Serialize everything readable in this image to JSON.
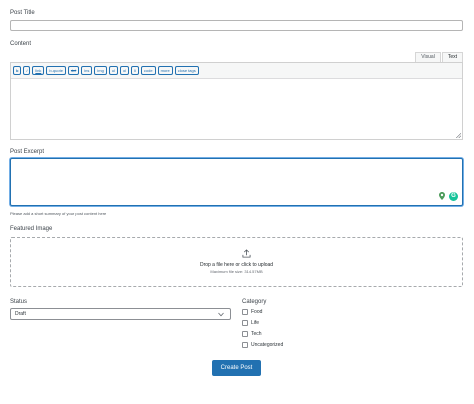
{
  "post_title": {
    "label": "Post Title",
    "value": ""
  },
  "content": {
    "label": "Content",
    "tabs": [
      "Visual",
      "Text"
    ],
    "active_tab": "Text",
    "toolbar": [
      "b",
      "i",
      "link",
      "b-quote",
      "del",
      "ins",
      "img",
      "ul",
      "ol",
      "li",
      "code",
      "more",
      "close tags"
    ],
    "value": ""
  },
  "excerpt": {
    "label": "Post Excerpt",
    "value": "",
    "help": "Please add a short summary of your post content here"
  },
  "featured_image": {
    "label": "Featured Image",
    "drop_text": "Drop a file here or click to upload",
    "max_size": "Maximum file size: 314.57MB"
  },
  "status": {
    "label": "Status",
    "selected": "Draft"
  },
  "category": {
    "label": "Category",
    "options": [
      "Food",
      "Life",
      "Tech",
      "Uncategorized"
    ]
  },
  "submit_label": "Create Post",
  "colors": {
    "accent": "#2271b1",
    "grammarly": "#15c39a"
  }
}
